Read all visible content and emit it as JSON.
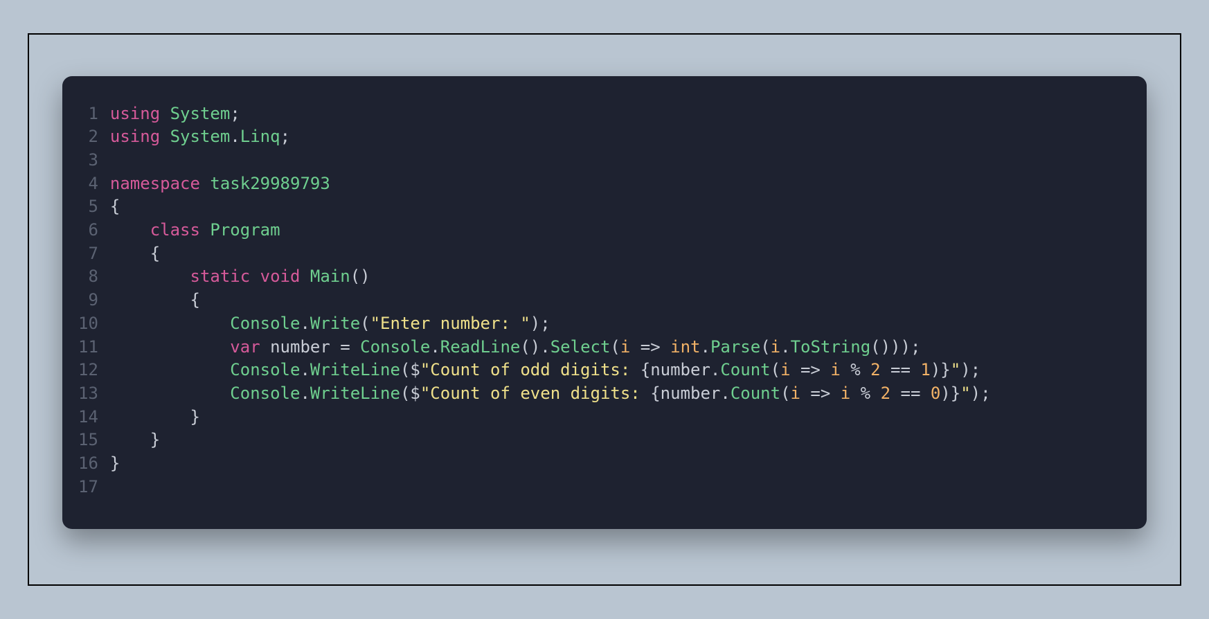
{
  "colors": {
    "page_bg": "#b9c5d1",
    "editor_bg": "#1e2230",
    "line_number": "#5b6272",
    "keyword": "#d65a9a",
    "type": "#6fcf8f",
    "punct": "#c9cdd6",
    "string": "#efe08a",
    "param": "#f2b267"
  },
  "code": {
    "language": "csharp",
    "lines": [
      {
        "n": 1,
        "tokens": [
          {
            "t": "using",
            "c": "tok-kw"
          },
          {
            "t": " ",
            "c": "tok-punc"
          },
          {
            "t": "System",
            "c": "tok-type"
          },
          {
            "t": ";",
            "c": "tok-punc"
          }
        ]
      },
      {
        "n": 2,
        "tokens": [
          {
            "t": "using",
            "c": "tok-kw"
          },
          {
            "t": " ",
            "c": "tok-punc"
          },
          {
            "t": "System",
            "c": "tok-type"
          },
          {
            "t": ".",
            "c": "tok-punc"
          },
          {
            "t": "Linq",
            "c": "tok-type"
          },
          {
            "t": ";",
            "c": "tok-punc"
          }
        ]
      },
      {
        "n": 3,
        "tokens": []
      },
      {
        "n": 4,
        "tokens": [
          {
            "t": "namespace",
            "c": "tok-kw"
          },
          {
            "t": " ",
            "c": "tok-punc"
          },
          {
            "t": "task29989793",
            "c": "tok-type"
          }
        ]
      },
      {
        "n": 5,
        "tokens": [
          {
            "t": "{",
            "c": "tok-punc"
          }
        ]
      },
      {
        "n": 6,
        "tokens": [
          {
            "t": "    ",
            "c": "tok-punc"
          },
          {
            "t": "class",
            "c": "tok-kw"
          },
          {
            "t": " ",
            "c": "tok-punc"
          },
          {
            "t": "Program",
            "c": "tok-type"
          }
        ]
      },
      {
        "n": 7,
        "tokens": [
          {
            "t": "    {",
            "c": "tok-punc"
          }
        ]
      },
      {
        "n": 8,
        "tokens": [
          {
            "t": "        ",
            "c": "tok-punc"
          },
          {
            "t": "static",
            "c": "tok-kw"
          },
          {
            "t": " ",
            "c": "tok-punc"
          },
          {
            "t": "void",
            "c": "tok-kw"
          },
          {
            "t": " ",
            "c": "tok-punc"
          },
          {
            "t": "Main",
            "c": "tok-type"
          },
          {
            "t": "()",
            "c": "tok-punc"
          }
        ]
      },
      {
        "n": 9,
        "tokens": [
          {
            "t": "        {",
            "c": "tok-punc"
          }
        ]
      },
      {
        "n": 10,
        "tokens": [
          {
            "t": "            ",
            "c": "tok-punc"
          },
          {
            "t": "Console",
            "c": "tok-type"
          },
          {
            "t": ".",
            "c": "tok-punc"
          },
          {
            "t": "Write",
            "c": "tok-type"
          },
          {
            "t": "(",
            "c": "tok-punc"
          },
          {
            "t": "\"Enter number: \"",
            "c": "tok-str"
          },
          {
            "t": ");",
            "c": "tok-punc"
          }
        ]
      },
      {
        "n": 11,
        "tokens": [
          {
            "t": "            ",
            "c": "tok-punc"
          },
          {
            "t": "var",
            "c": "tok-kw"
          },
          {
            "t": " number ",
            "c": "tok-punc"
          },
          {
            "t": "=",
            "c": "tok-op"
          },
          {
            "t": " ",
            "c": "tok-punc"
          },
          {
            "t": "Console",
            "c": "tok-type"
          },
          {
            "t": ".",
            "c": "tok-punc"
          },
          {
            "t": "ReadLine",
            "c": "tok-type"
          },
          {
            "t": "().",
            "c": "tok-punc"
          },
          {
            "t": "Select",
            "c": "tok-type"
          },
          {
            "t": "(",
            "c": "tok-punc"
          },
          {
            "t": "i",
            "c": "tok-param"
          },
          {
            "t": " ",
            "c": "tok-punc"
          },
          {
            "t": "=>",
            "c": "tok-op"
          },
          {
            "t": " ",
            "c": "tok-punc"
          },
          {
            "t": "int",
            "c": "tok-ityp"
          },
          {
            "t": ".",
            "c": "tok-punc"
          },
          {
            "t": "Parse",
            "c": "tok-type"
          },
          {
            "t": "(",
            "c": "tok-punc"
          },
          {
            "t": "i",
            "c": "tok-param"
          },
          {
            "t": ".",
            "c": "tok-punc"
          },
          {
            "t": "ToString",
            "c": "tok-type"
          },
          {
            "t": "()));",
            "c": "tok-punc"
          }
        ]
      },
      {
        "n": 12,
        "tokens": [
          {
            "t": "            ",
            "c": "tok-punc"
          },
          {
            "t": "Console",
            "c": "tok-type"
          },
          {
            "t": ".",
            "c": "tok-punc"
          },
          {
            "t": "WriteLine",
            "c": "tok-type"
          },
          {
            "t": "(",
            "c": "tok-punc"
          },
          {
            "t": "$",
            "c": "tok-strpre"
          },
          {
            "t": "\"Count of odd digits: ",
            "c": "tok-str"
          },
          {
            "t": "{",
            "c": "tok-punc"
          },
          {
            "t": "number.",
            "c": "tok-punc"
          },
          {
            "t": "Count",
            "c": "tok-type"
          },
          {
            "t": "(",
            "c": "tok-punc"
          },
          {
            "t": "i",
            "c": "tok-param"
          },
          {
            "t": " ",
            "c": "tok-punc"
          },
          {
            "t": "=>",
            "c": "tok-op"
          },
          {
            "t": " ",
            "c": "tok-punc"
          },
          {
            "t": "i",
            "c": "tok-param"
          },
          {
            "t": " % ",
            "c": "tok-op"
          },
          {
            "t": "2",
            "c": "tok-num"
          },
          {
            "t": " == ",
            "c": "tok-op"
          },
          {
            "t": "1",
            "c": "tok-num"
          },
          {
            "t": ")",
            "c": "tok-punc"
          },
          {
            "t": "}",
            "c": "tok-punc"
          },
          {
            "t": "\"",
            "c": "tok-str"
          },
          {
            "t": ");",
            "c": "tok-punc"
          }
        ]
      },
      {
        "n": 13,
        "tokens": [
          {
            "t": "            ",
            "c": "tok-punc"
          },
          {
            "t": "Console",
            "c": "tok-type"
          },
          {
            "t": ".",
            "c": "tok-punc"
          },
          {
            "t": "WriteLine",
            "c": "tok-type"
          },
          {
            "t": "(",
            "c": "tok-punc"
          },
          {
            "t": "$",
            "c": "tok-strpre"
          },
          {
            "t": "\"Count of even digits: ",
            "c": "tok-str"
          },
          {
            "t": "{",
            "c": "tok-punc"
          },
          {
            "t": "number.",
            "c": "tok-punc"
          },
          {
            "t": "Count",
            "c": "tok-type"
          },
          {
            "t": "(",
            "c": "tok-punc"
          },
          {
            "t": "i",
            "c": "tok-param"
          },
          {
            "t": " ",
            "c": "tok-punc"
          },
          {
            "t": "=>",
            "c": "tok-op"
          },
          {
            "t": " ",
            "c": "tok-punc"
          },
          {
            "t": "i",
            "c": "tok-param"
          },
          {
            "t": " % ",
            "c": "tok-op"
          },
          {
            "t": "2",
            "c": "tok-num"
          },
          {
            "t": " == ",
            "c": "tok-op"
          },
          {
            "t": "0",
            "c": "tok-num"
          },
          {
            "t": ")",
            "c": "tok-punc"
          },
          {
            "t": "}",
            "c": "tok-punc"
          },
          {
            "t": "\"",
            "c": "tok-str"
          },
          {
            "t": ");",
            "c": "tok-punc"
          }
        ]
      },
      {
        "n": 14,
        "tokens": [
          {
            "t": "        }",
            "c": "tok-punc"
          }
        ]
      },
      {
        "n": 15,
        "tokens": [
          {
            "t": "    }",
            "c": "tok-punc"
          }
        ]
      },
      {
        "n": 16,
        "tokens": [
          {
            "t": "}",
            "c": "tok-punc"
          }
        ]
      },
      {
        "n": 17,
        "tokens": []
      }
    ]
  }
}
